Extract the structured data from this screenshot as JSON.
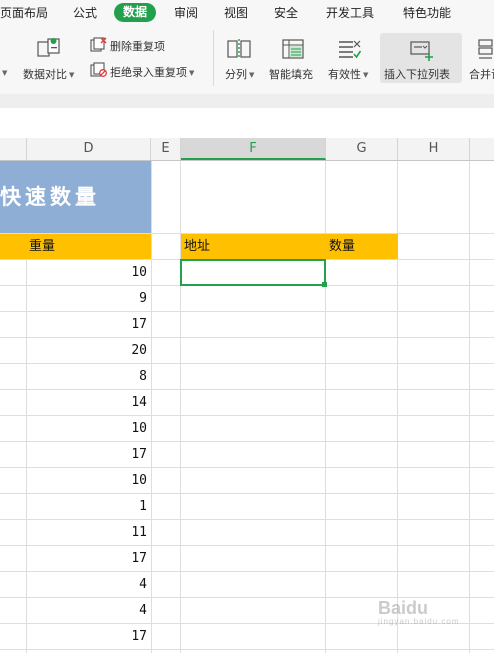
{
  "menu": {
    "tabs": [
      "页面布局",
      "公式",
      "数据",
      "审阅",
      "视图",
      "安全",
      "开发工具",
      "特色功能"
    ],
    "active_tab": "数据"
  },
  "ribbon": {
    "data_compare": "数据对比",
    "delete_duplicates": "删除重复项",
    "reject_duplicates": "拒绝录入重复项",
    "split_columns": "分列",
    "smart_fill": "智能填充",
    "validity": "有效性",
    "insert_dropdown": "插入下拉列表",
    "merge_calc": "合并计"
  },
  "columns": [
    "D",
    "E",
    "F",
    "G",
    "H"
  ],
  "selected_column": "F",
  "sheet": {
    "title": "快速数量",
    "header_weight": "重量",
    "header_address": "地址",
    "header_quantity": "数量",
    "weights": [
      "10",
      "9",
      "17",
      "20",
      "8",
      "14",
      "10",
      "17",
      "10",
      "1",
      "11",
      "17",
      "4",
      "4",
      "17"
    ]
  },
  "watermark": {
    "text": "Baidu",
    "sub": "jingyan.baidu.com"
  },
  "colors": {
    "accent": "#22a04b",
    "title_fill": "#8eaed6",
    "header_fill": "#ffc000"
  }
}
